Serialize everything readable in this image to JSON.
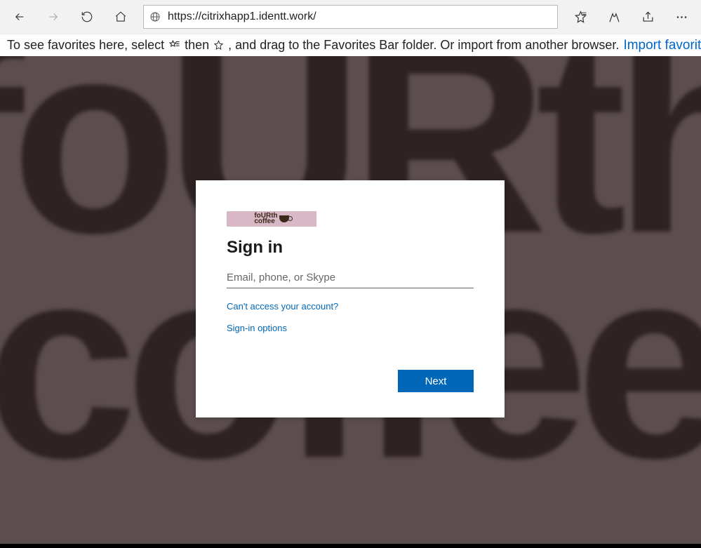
{
  "toolbar": {
    "url": "https://citrixhapp1.identt.work/"
  },
  "favbar": {
    "t1": "To see favorites here, select ",
    "t2": " then ",
    "t3": ", and drag to the Favorites Bar folder. Or import from another browser.",
    "import_link": "Import favorites"
  },
  "signin": {
    "brand": "foURth\ncoffee",
    "title": "Sign in",
    "placeholder": "Email, phone, or Skype",
    "cant_access": "Can't access your account?",
    "options": "Sign-in options",
    "next": "Next"
  }
}
